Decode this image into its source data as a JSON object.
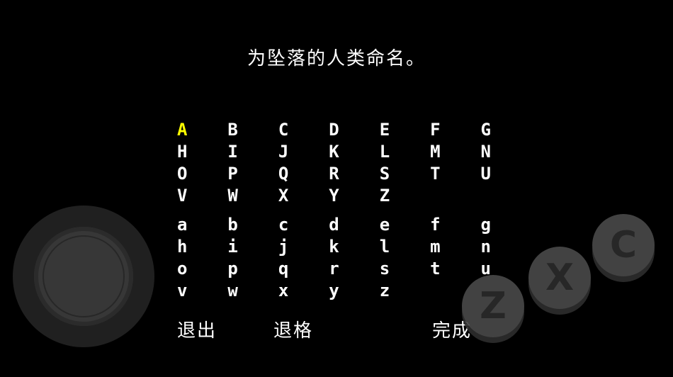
{
  "title": "为坠落的人类命名。",
  "letters": {
    "upper": [
      [
        "A",
        "B",
        "C",
        "D",
        "E",
        "F",
        "G"
      ],
      [
        "H",
        "I",
        "J",
        "K",
        "L",
        "M",
        "N"
      ],
      [
        "O",
        "P",
        "Q",
        "R",
        "S",
        "T",
        "U"
      ],
      [
        "V",
        "W",
        "X",
        "Y",
        "Z",
        "",
        ""
      ]
    ],
    "lower": [
      [
        "a",
        "b",
        "c",
        "d",
        "e",
        "f",
        "g"
      ],
      [
        "h",
        "i",
        "j",
        "k",
        "l",
        "m",
        "n"
      ],
      [
        "o",
        "p",
        "q",
        "r",
        "s",
        "t",
        "u"
      ],
      [
        "v",
        "w",
        "x",
        "y",
        "z",
        "",
        ""
      ]
    ],
    "selected": "A"
  },
  "actions": {
    "quit": "退出",
    "backspace": "退格",
    "done": "完成"
  },
  "controls": {
    "z_label": "Z",
    "x_label": "X",
    "c_label": "C"
  },
  "colors": {
    "selected": "#ffff00",
    "text": "#ffffff",
    "background": "#000000"
  }
}
